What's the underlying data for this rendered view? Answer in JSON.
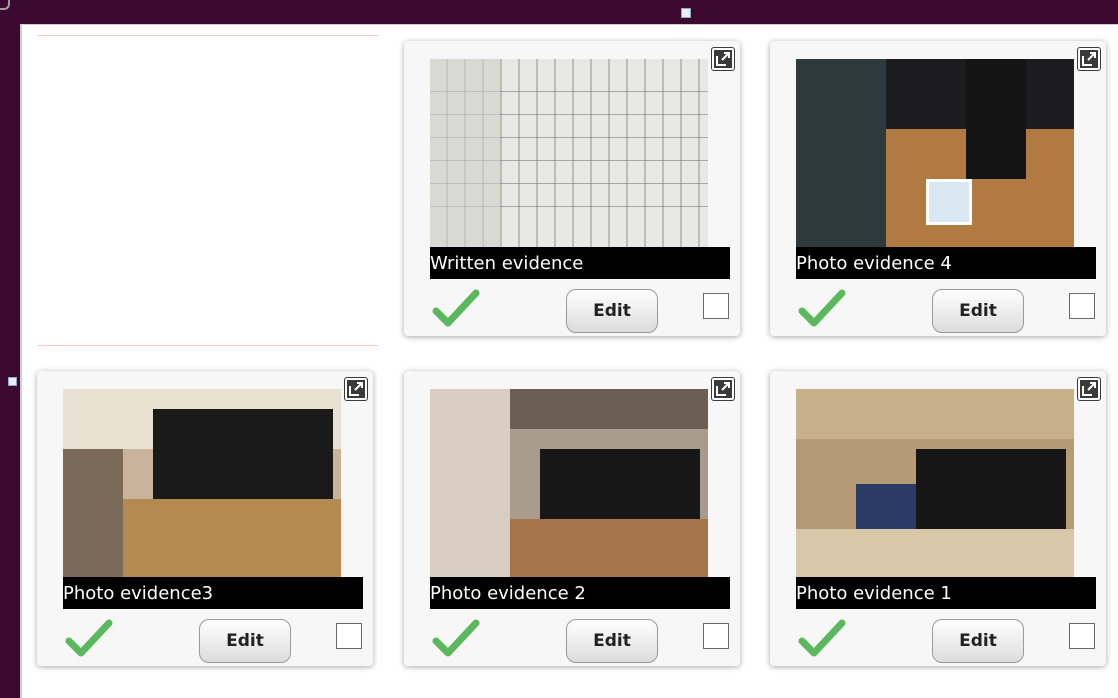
{
  "cards": [
    {
      "caption": "Written evidence",
      "edit_label": "Edit"
    },
    {
      "caption": "Photo evidence 4",
      "edit_label": "Edit"
    },
    {
      "caption": "Photo evidence3",
      "edit_label": "Edit"
    },
    {
      "caption": "Photo evidence 2",
      "edit_label": "Edit"
    },
    {
      "caption": "Photo evidence 1",
      "edit_label": "Edit"
    }
  ],
  "icons": {
    "popout": "external-link-icon",
    "status": "checkmark-icon"
  },
  "colors": {
    "check_green": "#5cb85c",
    "caption_bg": "#000000",
    "page_bg": "#3c0a30"
  }
}
